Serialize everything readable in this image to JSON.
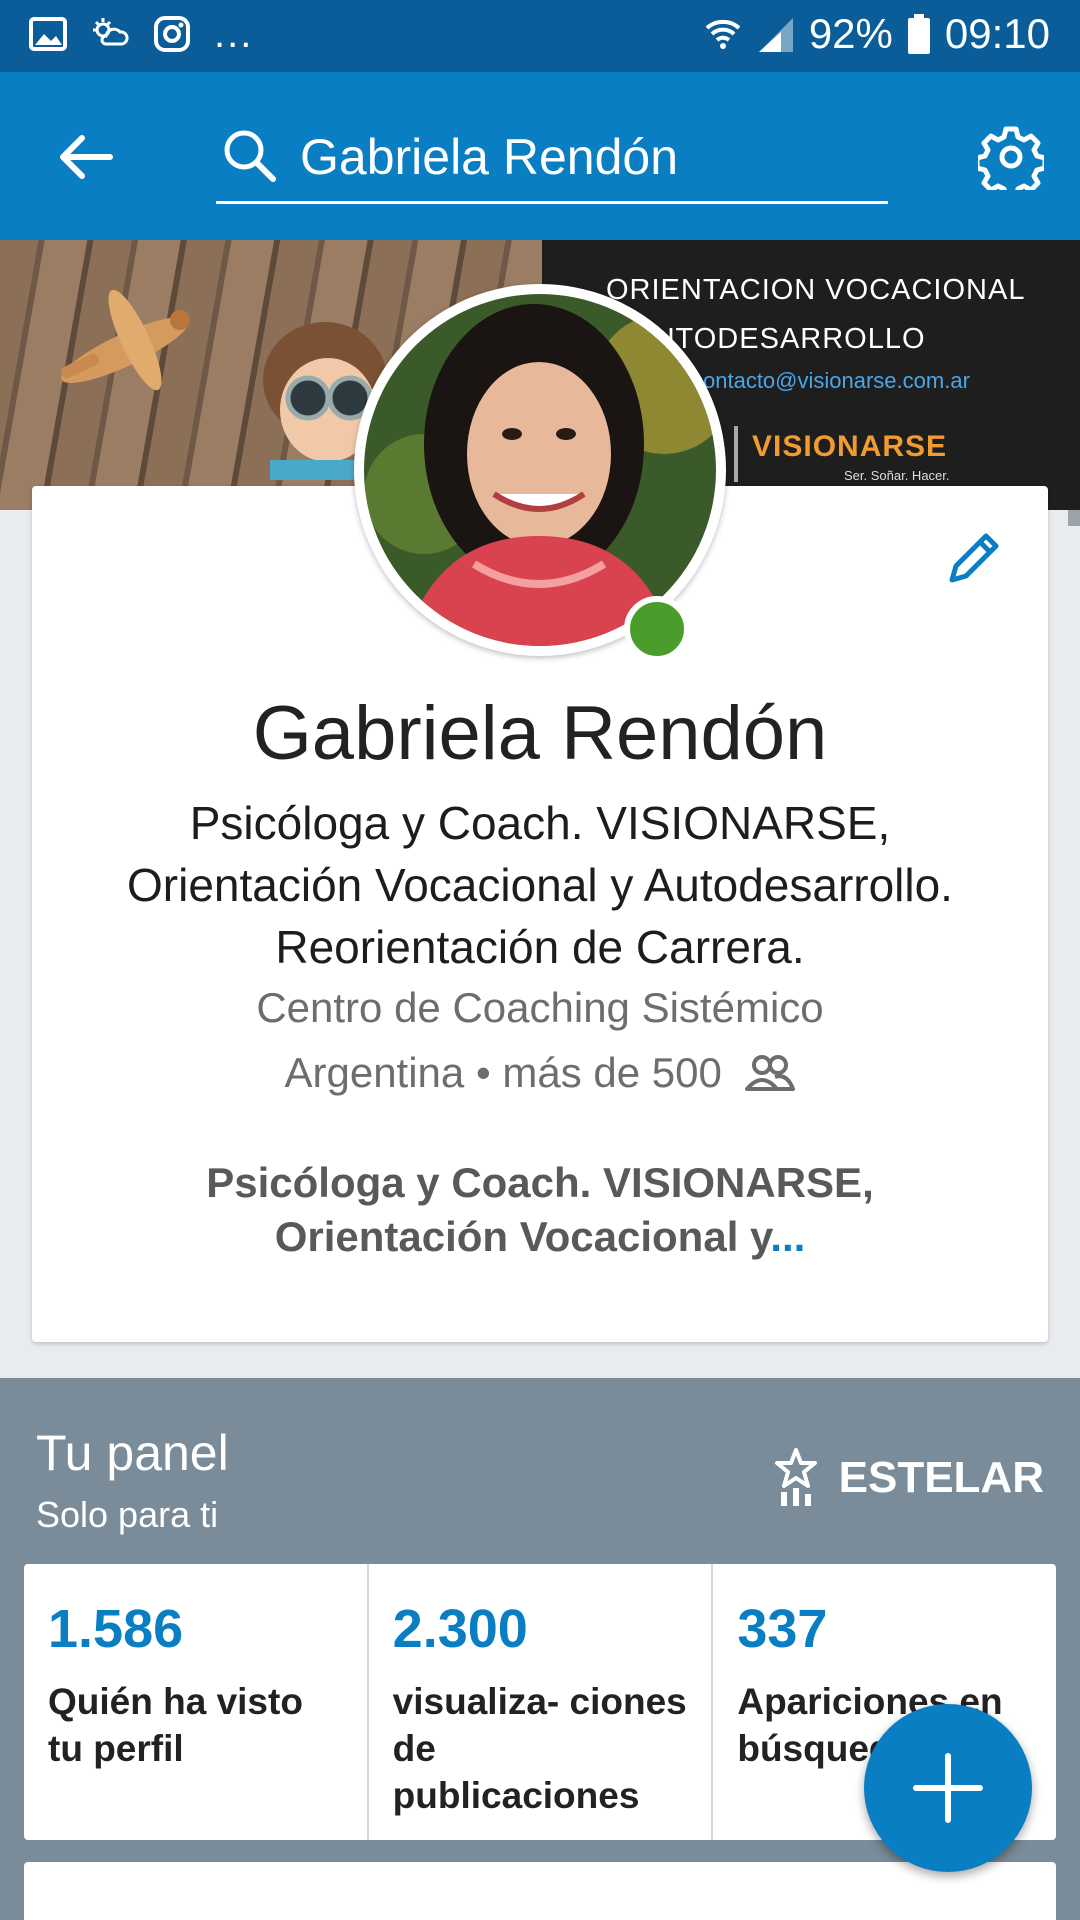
{
  "status_bar": {
    "battery": "92%",
    "time": "09:10",
    "overflow": "...",
    "icons": [
      "image-icon",
      "weather-icon",
      "instagram-icon",
      "wifi-icon",
      "signal-icon",
      "battery-icon"
    ]
  },
  "app_bar": {
    "search_text": "Gabriela Rendón",
    "icons": [
      "back-arrow-icon",
      "search-icon",
      "gear-icon"
    ]
  },
  "banner": {
    "title_line1": "ORIENTACION VOCACIONAL",
    "title_line2": "Y AUTODESARROLLO",
    "email": "contacto@visionarse.com.ar",
    "brand": "VISIONARSE",
    "tagline": "Ser. Soñar. Hacer."
  },
  "profile": {
    "name": "Gabriela Rendón",
    "headline": "Psicóloga y Coach. VISIONARSE, Orientación Vocacional y Autodesarrollo. Reorientación de Carrera.",
    "company": "Centro de Coaching Sistémico",
    "location": "Argentina",
    "separator": "•",
    "connections": "más de 500",
    "summary": "Psicóloga y Coach. VISIONARSE, Orientación Vocacional y",
    "summary_more": "...",
    "online_color": "#4a9d2a"
  },
  "dashboard": {
    "title": "Tu panel",
    "subtitle": "Solo para ti",
    "estelar_label": "ESTELAR",
    "stats": [
      {
        "value": "1.586",
        "label": "Quién ha visto tu perfil"
      },
      {
        "value": "2.300",
        "label": "visualiza- ciones de publicaciones"
      },
      {
        "value": "337",
        "label": "Apariciones en búsquedas"
      }
    ]
  },
  "colors": {
    "status_bar": "#0a5d99",
    "app_bar": "#0a7ec2",
    "accent": "#0a7ec2",
    "dashboard_bg": "#7a8c99"
  }
}
